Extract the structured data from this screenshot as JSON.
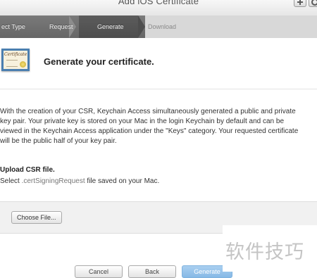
{
  "window": {
    "title": "Add iOS Certificate",
    "add_icon": "plus-icon",
    "search_icon": "search-icon"
  },
  "steps": [
    {
      "label": "ect Type",
      "state": "done"
    },
    {
      "label": "Request",
      "state": "done"
    },
    {
      "label": "Generate",
      "state": "current"
    },
    {
      "label": "Download",
      "state": "future"
    }
  ],
  "header": {
    "icon": "certificate-icon",
    "title": "Generate your certificate."
  },
  "body": {
    "description": "With the creation of your CSR, Keychain Access simultaneously generated a public and private key pair. Your private key is stored on your Mac in the login Keychain by default and can be viewed in the Keychain Access application under the \"Keys\" category. Your requested certificate will be the public half of your key pair.",
    "upload_title": "Upload CSR file.",
    "upload_prefix": "Select ",
    "upload_ext": ".certSigningRequest",
    "upload_suffix": " file saved on your Mac."
  },
  "file_input": {
    "button_label": "Choose File..."
  },
  "footer": {
    "cancel_label": "Cancel",
    "back_label": "Back",
    "generate_label": "Generate"
  },
  "watermark": {
    "text": "软件技巧"
  },
  "colors": {
    "stepbar": "#707070",
    "current_step": "#555555",
    "primary_button": "#8fc0ea"
  }
}
